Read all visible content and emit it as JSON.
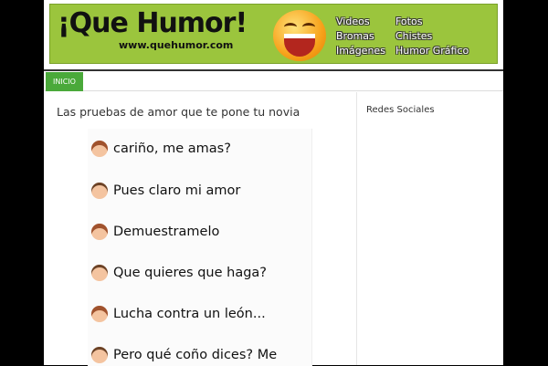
{
  "header": {
    "logo_text": "¡Que Humor!",
    "logo_url": "www.quehumor.com",
    "links": [
      "Videos",
      "Fotos",
      "Bromas",
      "Chistes",
      "Imágenes",
      "Humor Gráfico"
    ]
  },
  "menu": {
    "home_label": "INICIO"
  },
  "post": {
    "title": "Las pruebas de amor que te pone tu novia",
    "messages": [
      {
        "speaker": "girl",
        "text": "cariño, me amas?"
      },
      {
        "speaker": "boy",
        "text": "Pues claro mi amor"
      },
      {
        "speaker": "girl",
        "text": "Demuestramelo"
      },
      {
        "speaker": "boy",
        "text": "Que quieres que haga?"
      },
      {
        "speaker": "girl",
        "text": "Lucha contra un león..."
      },
      {
        "speaker": "boy",
        "text": "Pero qué coño dices? Me"
      }
    ]
  },
  "sidebar": {
    "title": "Redes Sociales"
  },
  "colors": {
    "banner_bg": "#9bc53d",
    "menu_active": "#4aa93a",
    "page_bg": "#000000"
  }
}
